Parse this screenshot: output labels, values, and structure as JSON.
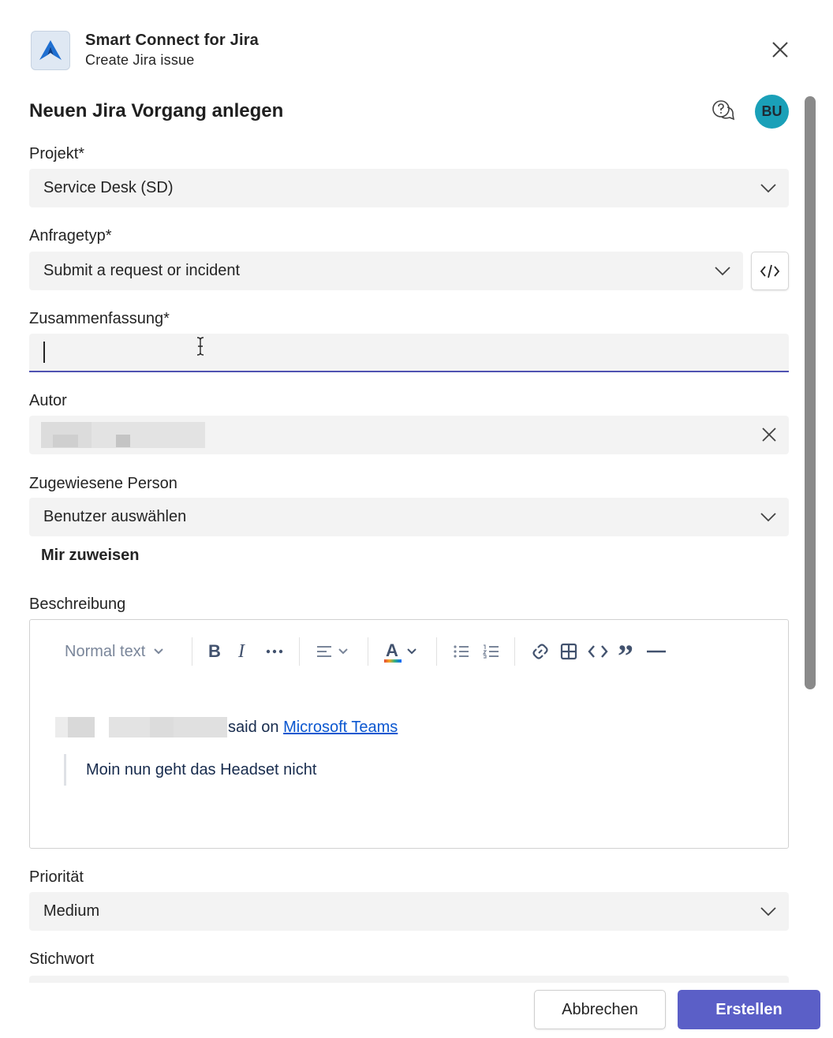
{
  "app": {
    "title": "Smart Connect for Jira",
    "subtitle": "Create Jira issue",
    "logo_icon": "jira-logo-icon"
  },
  "form": {
    "title": "Neuen Jira Vorgang anlegen",
    "avatar_initials": "BU",
    "avatar_color": "#1aa0b8"
  },
  "fields": {
    "project": {
      "label": "Projekt*",
      "value": "Service Desk (SD)"
    },
    "request_type": {
      "label": "Anfragetyp*",
      "value": "Submit a request or incident"
    },
    "summary": {
      "label": "Zusammenfassung*",
      "value": ""
    },
    "author": {
      "label": "Autor"
    },
    "assignee": {
      "label": "Zugewiesene Person",
      "value": "Benutzer auswählen",
      "assign_me": "Mir zuweisen"
    },
    "description": {
      "label": "Beschreibung",
      "toolbar": {
        "text_style": "Normal text"
      },
      "said_on": "said on ",
      "link_text": "Microsoft Teams",
      "quote": "Moin nun geht das Headset nicht"
    },
    "priority": {
      "label": "Priorität",
      "value": "Medium"
    },
    "keyword": {
      "label": "Stichwort"
    }
  },
  "buttons": {
    "cancel": "Abbrechen",
    "create": "Erstellen"
  },
  "colors": {
    "accent": "#5b5fc7",
    "focus_underline": "#4f52b2",
    "link": "#0b57d0"
  }
}
